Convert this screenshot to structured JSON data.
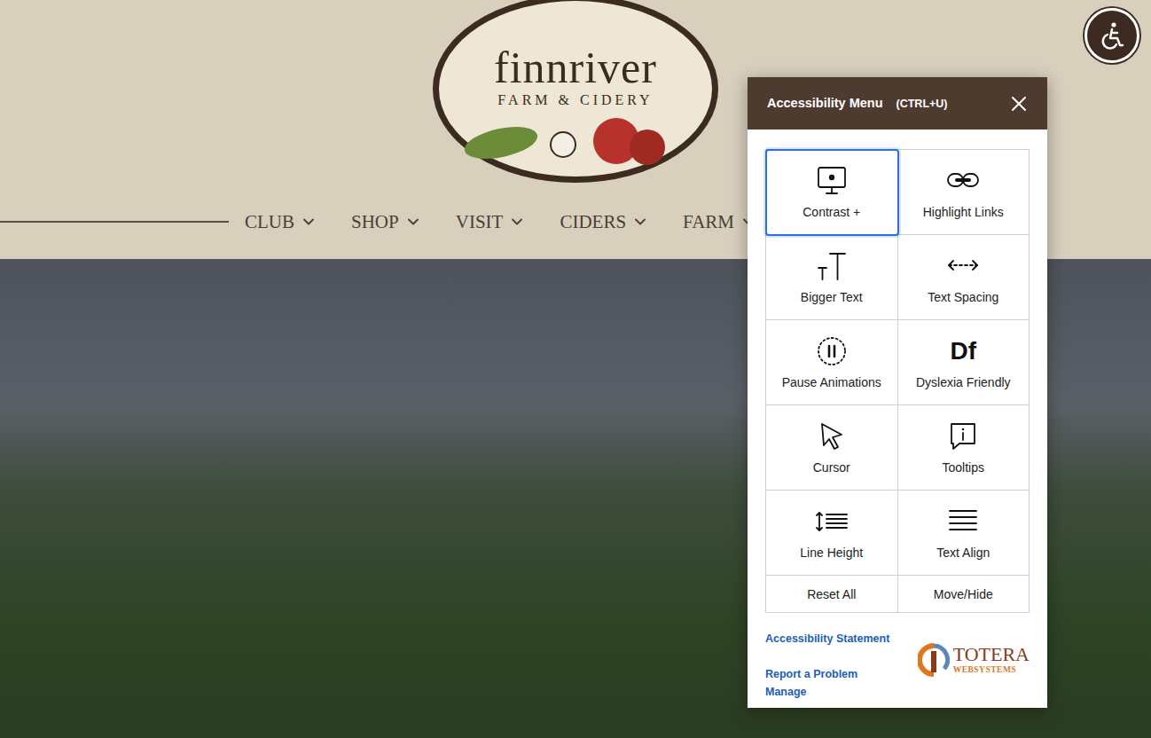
{
  "site": {
    "logo_name": "finnriver",
    "logo_tagline": "FARM & CIDERY"
  },
  "nav": [
    {
      "label": "CLUB"
    },
    {
      "label": "SHOP"
    },
    {
      "label": "VISIT"
    },
    {
      "label": "CIDERS"
    },
    {
      "label": "FARM"
    }
  ],
  "accessibility_menu": {
    "title": "Accessibility Menu",
    "shortcut": "(CTRL+U)",
    "options": [
      {
        "label": "Contrast +",
        "selected": true
      },
      {
        "label": "Highlight Links",
        "selected": false
      },
      {
        "label": "Bigger Text",
        "selected": false
      },
      {
        "label": "Text Spacing",
        "selected": false
      },
      {
        "label": "Pause Animations",
        "selected": false
      },
      {
        "label": "Dyslexia Friendly",
        "selected": false,
        "glyph": "Df"
      },
      {
        "label": "Cursor",
        "selected": false
      },
      {
        "label": "Tooltips",
        "selected": false
      },
      {
        "label": "Line Height",
        "selected": false
      },
      {
        "label": "Text Align",
        "selected": false
      }
    ],
    "actions": [
      {
        "label": "Reset All"
      },
      {
        "label": "Move/Hide"
      }
    ],
    "links": [
      "Accessibility Statement",
      "Report a Problem",
      "Manage"
    ],
    "vendor": {
      "name": "TOTERA",
      "sub": "WEBSYSTEMS"
    }
  }
}
